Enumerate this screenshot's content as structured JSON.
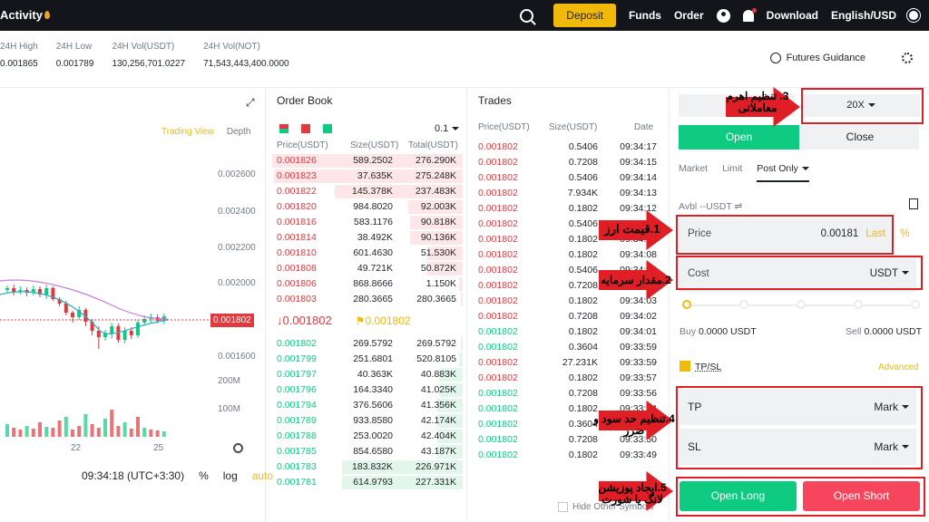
{
  "header": {
    "brand": "Activity",
    "deposit": "Deposit",
    "funds": "Funds",
    "order": "Order",
    "download": "Download",
    "language": "English/USD"
  },
  "stats": [
    {
      "label": "24H High",
      "value": "0.001865"
    },
    {
      "label": "24H Low",
      "value": "0.001789"
    },
    {
      "label": "24H Vol(USDT)",
      "value": "130,256,701.0227"
    },
    {
      "label": "24H Vol(NOT)",
      "value": "71,543,443,400.0000"
    }
  ],
  "futures_guidance": "Futures Guidance",
  "chart": {
    "trading_view": "Trading View",
    "depth": "Depth",
    "y_ticks": [
      "0.002600",
      "0.002400",
      "0.002200",
      "0.002000",
      "0.001600"
    ],
    "current_price": "0.001802",
    "vol_ticks": [
      "200M",
      "100M"
    ],
    "x_ticks": [
      "22",
      "25"
    ],
    "time": "09:34:18 (UTC+3:30)",
    "pct": "%",
    "log": "log",
    "auto": "auto",
    "accent": "#f0b90b",
    "up_color": "#0ecb81",
    "down_color": "#e0393e"
  },
  "orderbook": {
    "title": "Order Book",
    "tick": "0.1",
    "headers": {
      "price": "Price(USDT)",
      "size": "Size(USDT)",
      "total": "Total(USDT)"
    },
    "asks": [
      {
        "p": "0.001826",
        "s": "589.2502",
        "t": "276.290K",
        "d": 0.98
      },
      {
        "p": "0.001823",
        "s": "37.635K",
        "t": "275.248K",
        "d": 0.97
      },
      {
        "p": "0.001822",
        "s": "145.378K",
        "t": "237.483K",
        "d": 0.66
      },
      {
        "p": "0.001820",
        "s": "984.8020",
        "t": "92.003K",
        "d": 0.28
      },
      {
        "p": "0.001816",
        "s": "583.1176",
        "t": "90.818K",
        "d": 0.27
      },
      {
        "p": "0.001814",
        "s": "38.492K",
        "t": "90.136K",
        "d": 0.27
      },
      {
        "p": "0.001810",
        "s": "601.4630",
        "t": "51.530K",
        "d": 0.18
      },
      {
        "p": "0.001808",
        "s": "49.721K",
        "t": "50.872K",
        "d": 0.18
      },
      {
        "p": "0.001806",
        "s": "868.8666",
        "t": "1.150K",
        "d": 0.02
      },
      {
        "p": "0.001803",
        "s": "280.3665",
        "t": "280.3665",
        "d": 0.01
      }
    ],
    "mid_price": "↓0.001802",
    "mark_price": "0.001802",
    "bids": [
      {
        "p": "0.001802",
        "s": "269.5792",
        "t": "269.5792",
        "d": 0.01
      },
      {
        "p": "0.001799",
        "s": "251.6801",
        "t": "520.8105",
        "d": 0.02
      },
      {
        "p": "0.001797",
        "s": "40.363K",
        "t": "40.883K",
        "d": 0.12
      },
      {
        "p": "0.001796",
        "s": "164.3340",
        "t": "41.025K",
        "d": 0.12
      },
      {
        "p": "0.001794",
        "s": "376.5606",
        "t": "41.356K",
        "d": 0.13
      },
      {
        "p": "0.001789",
        "s": "933.8580",
        "t": "42.174K",
        "d": 0.13
      },
      {
        "p": "0.001788",
        "s": "253.0020",
        "t": "42.404K",
        "d": 0.13
      },
      {
        "p": "0.001785",
        "s": "854.6580",
        "t": "43.187K",
        "d": 0.13
      },
      {
        "p": "0.001783",
        "s": "183.832K",
        "t": "226.971K",
        "d": 0.62
      },
      {
        "p": "0.001781",
        "s": "614.9793",
        "t": "227.331K",
        "d": 0.62
      }
    ]
  },
  "trades": {
    "title": "Trades",
    "headers": {
      "price": "Price(USDT)",
      "size": "Size(USDT)",
      "date": "Date"
    },
    "rows": [
      {
        "p": "0.001802",
        "s": "0.5406",
        "t": "09:34:17",
        "side": "sell"
      },
      {
        "p": "0.001802",
        "s": "0.7208",
        "t": "09:34:15",
        "side": "sell"
      },
      {
        "p": "0.001802",
        "s": "0.5406",
        "t": "09:34:14",
        "side": "sell"
      },
      {
        "p": "0.001802",
        "s": "7.934K",
        "t": "09:34:13",
        "side": "sell"
      },
      {
        "p": "0.001802",
        "s": "0.1802",
        "t": "09:34:12",
        "side": "sell"
      },
      {
        "p": "0.001802",
        "s": "0.5406",
        "t": "09:34:11",
        "side": "sell"
      },
      {
        "p": "0.001802",
        "s": "0.1802",
        "t": "09:34:09",
        "side": "sell"
      },
      {
        "p": "0.001802",
        "s": "0.1802",
        "t": "09:34:08",
        "side": "sell"
      },
      {
        "p": "0.001802",
        "s": "0.5406",
        "t": "09:34:06",
        "side": "sell"
      },
      {
        "p": "0.001802",
        "s": "0.7208",
        "t": "09:34:04",
        "side": "sell"
      },
      {
        "p": "0.001802",
        "s": "0.1802",
        "t": "09:34:03",
        "side": "sell"
      },
      {
        "p": "0.001802",
        "s": "0.7208",
        "t": "09:34:02",
        "side": "sell"
      },
      {
        "p": "0.001802",
        "s": "0.1802",
        "t": "09:34:01",
        "side": "buy"
      },
      {
        "p": "0.001802",
        "s": "0.3604",
        "t": "09:33:59",
        "side": "buy"
      },
      {
        "p": "0.001802",
        "s": "27.231K",
        "t": "09:33:59",
        "side": "sell"
      },
      {
        "p": "0.001802",
        "s": "0.1802",
        "t": "09:33:57",
        "side": "sell"
      },
      {
        "p": "0.001802",
        "s": "0.7208",
        "t": "09:33:56",
        "side": "buy"
      },
      {
        "p": "0.001802",
        "s": "0.1802",
        "t": "09:33:54",
        "side": "buy"
      },
      {
        "p": "0.001802",
        "s": "0.3604",
        "t": "09:33:52",
        "side": "buy"
      },
      {
        "p": "0.001802",
        "s": "0.7208",
        "t": "09:33:50",
        "side": "buy"
      },
      {
        "p": "0.001802",
        "s": "0.1802",
        "t": "09:33:49",
        "side": "buy"
      }
    ],
    "hide_other": "Hide Other Symbols"
  },
  "form": {
    "leverage": "20X",
    "open_tab": "Open",
    "close_tab": "Close",
    "order_types": [
      "Market",
      "Limit",
      "Post Only"
    ],
    "avbl": "Avbl --USDT",
    "price_label": "Price",
    "price_value": "0.00181",
    "price_last": "Last",
    "cost_label": "Cost",
    "cost_unit": "USDT",
    "buy": "Buy",
    "buy_value": "0.0000 USDT",
    "sell": "Sell",
    "sell_value": "0.0000 USDT",
    "tpsl": "TP/SL",
    "advanced": "Advanced",
    "tp_label": "TP",
    "tp_value": "Mark",
    "sl_label": "SL",
    "sl_value": "Mark",
    "open_long": "Open Long",
    "open_short": "Open Short",
    "slider_level": 0
  },
  "annotations": {
    "a1": "1.قیمت ارز",
    "a2": "2.مقدار سرمایه",
    "a3": "3. تنظیم اهرم معاملاتی",
    "a4": "4.تنظیم حد سود و ضرر",
    "a5": "5.ایجاد پوزیشن لانگ یا شورت",
    "color": "#e01e25"
  }
}
